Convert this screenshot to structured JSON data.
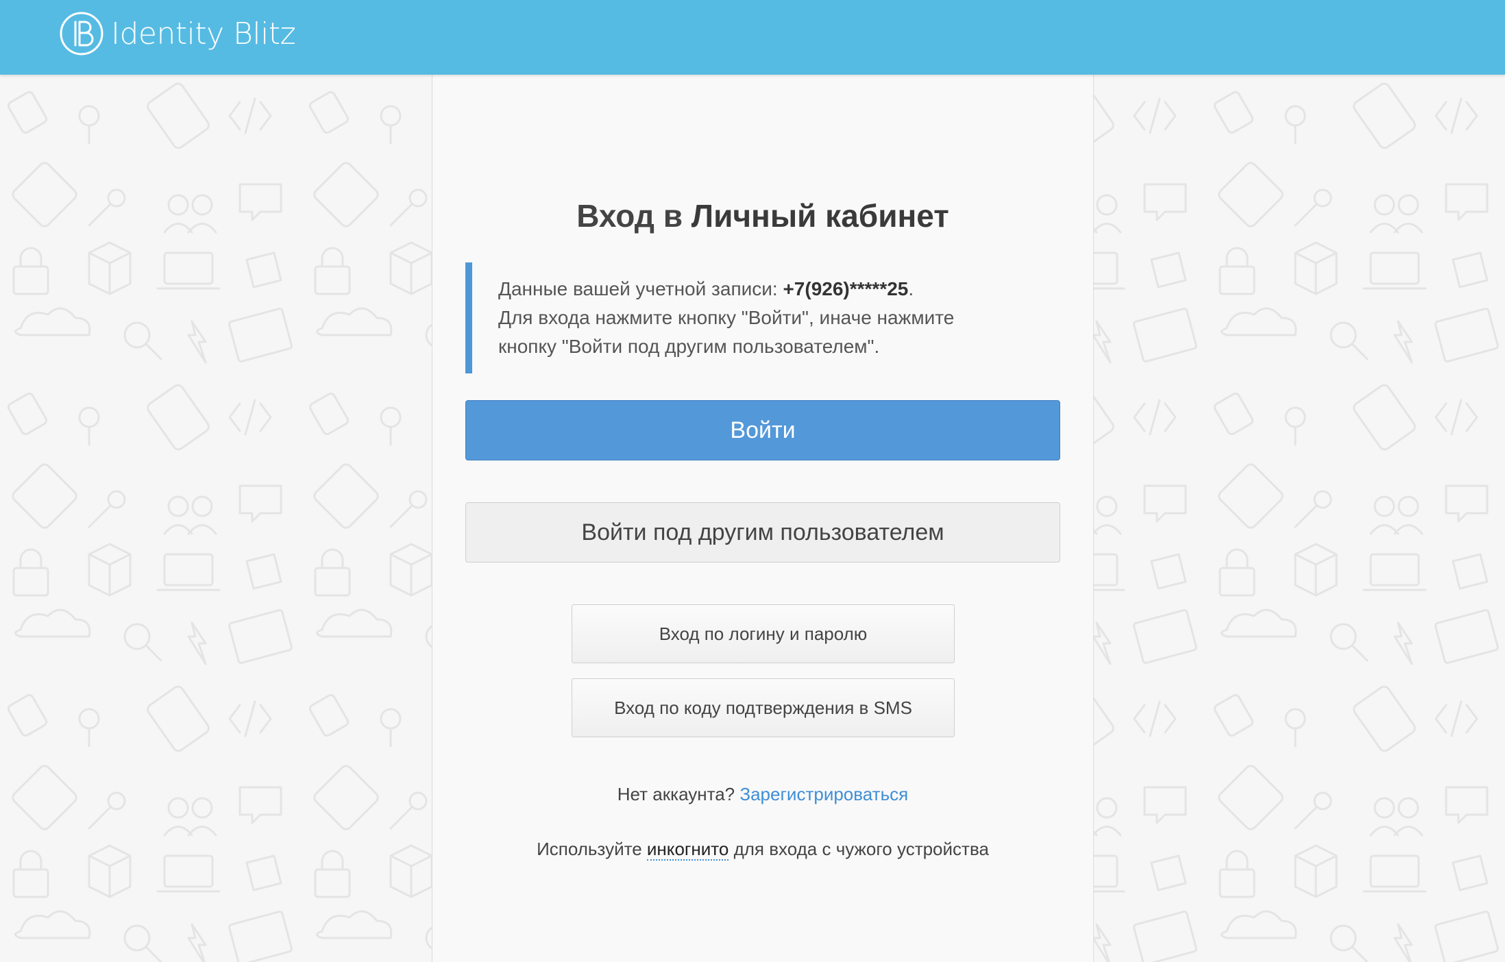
{
  "header": {
    "brand_name": "Identity Blitz",
    "background_color": "#56bbe3"
  },
  "main": {
    "title_prefix": "Вход в ",
    "title_strong": "Личный кабинет",
    "notice": {
      "account_label": "Данные вашей учетной записи: ",
      "account_value": "+7(926)*****25",
      "account_suffix": ".",
      "line2": "Для входа нажмите кнопку \"Войти\", иначе нажмите",
      "line3": "кнопку \"Войти под другим пользователем\"."
    },
    "login_button": "Войти",
    "other_user_button": "Войти под другим пользователем",
    "password_login_button": "Вход по логину и паролю",
    "sms_login_button": "Вход по коду подтверждения в SMS",
    "register_prompt": "Нет аккаунта? ",
    "register_link": "Зарегистрироваться",
    "incognito_prefix": "Используйте ",
    "incognito_term": "инкогнито",
    "incognito_suffix": " для входа с чужого устройства"
  },
  "colors": {
    "accent": "#5398d9",
    "link": "#3f8ed6",
    "notice_border": "#4d97d7"
  }
}
